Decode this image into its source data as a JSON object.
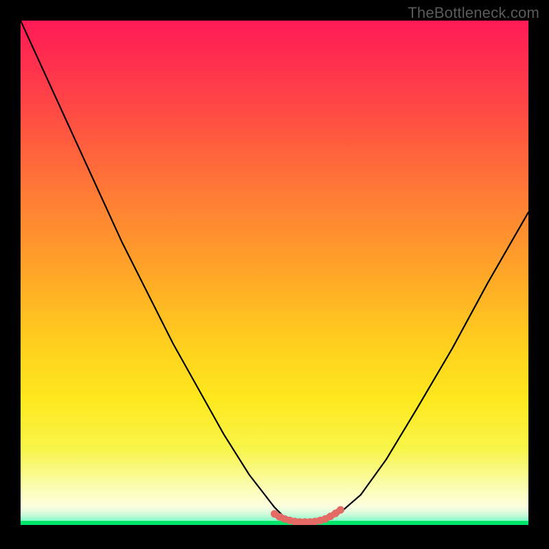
{
  "watermark": "TheBottleneck.com",
  "chart_data": {
    "type": "line",
    "title": "",
    "xlabel": "",
    "ylabel": "",
    "xlim": [
      0,
      100
    ],
    "ylim": [
      0,
      100
    ],
    "series": [
      {
        "name": "bottleneck-curve",
        "x": [
          0,
          5,
          10,
          15,
          20,
          25,
          30,
          35,
          40,
          45,
          50,
          52,
          55,
          58,
          60,
          63,
          67,
          72,
          78,
          85,
          92,
          100
        ],
        "values": [
          100,
          89,
          78,
          67,
          56,
          46,
          36,
          27,
          18,
          10,
          3.5,
          1.5,
          0.5,
          0.5,
          0.8,
          2.5,
          6,
          13,
          23,
          35,
          48,
          62
        ]
      },
      {
        "name": "optimal-zone-marker",
        "x": [
          50,
          51,
          52,
          53,
          54,
          55,
          56,
          57,
          58,
          59,
          60,
          61,
          62,
          63
        ],
        "values": [
          2.2,
          1.6,
          1.2,
          0.9,
          0.7,
          0.6,
          0.6,
          0.6,
          0.7,
          0.9,
          1.2,
          1.7,
          2.3,
          3.0
        ]
      }
    ],
    "annotations": [],
    "background": {
      "type": "vertical-gradient",
      "stops": [
        {
          "pos": 0.0,
          "color": "#ff1a56"
        },
        {
          "pos": 0.5,
          "color": "#ffa628"
        },
        {
          "pos": 0.8,
          "color": "#f8f54a"
        },
        {
          "pos": 0.97,
          "color": "#fdfee6"
        },
        {
          "pos": 1.0,
          "color": "#00e56a"
        }
      ]
    },
    "curve_color": "#000000",
    "marker_color": "#e46a66"
  }
}
